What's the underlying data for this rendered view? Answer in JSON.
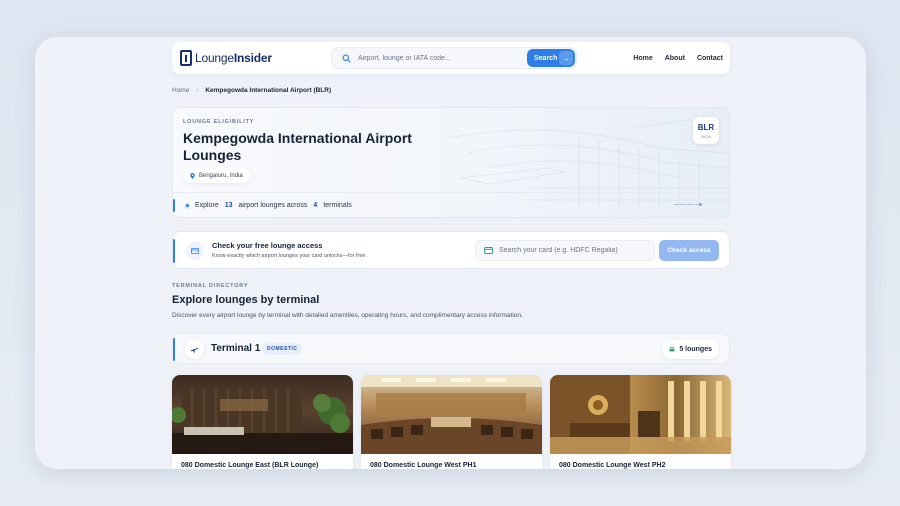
{
  "brand": {
    "logo_text_bold": "Lounge",
    "logo_text_rest": "Insider"
  },
  "search": {
    "placeholder": "Airport, lounge or IATA code...",
    "button_label": "Search"
  },
  "nav": {
    "links": [
      "Home",
      "About",
      "Contact"
    ]
  },
  "breadcrumb": {
    "home": "Home",
    "current": "Kempegowda International Airport (BLR)"
  },
  "hero": {
    "eyebrow": "LOUNGE ELIGIBILITY",
    "title_line1": "Kempegowda International Airport",
    "title_line2": "Lounges",
    "location": "Bengaluru, India",
    "iata_code": "BLR",
    "iata_label": "IATA",
    "explore_prefix": "Explore",
    "lounge_count": "13",
    "explore_middle": "airport lounges across",
    "terminal_count": "4",
    "explore_suffix": "terminals"
  },
  "check_access": {
    "title": "Check your free lounge access",
    "subtitle": "Know exactly which airport lounges your card unlocks—for free.",
    "input_placeholder": "Search your card (e.g. HDFC Regalia)",
    "button_label": "Check access"
  },
  "directory": {
    "eyebrow": "TERMINAL DIRECTORY",
    "title": "Explore lounges by terminal",
    "subtitle": "Discover every airport lounge by terminal with detailed amenities, operating hours, and complimentary access information."
  },
  "terminal": {
    "name": "Terminal 1",
    "badge": "DOMESTIC",
    "count": "5 lounges"
  },
  "lounges": [
    {
      "name": "080 Domestic Lounge East (BLR Lounge)"
    },
    {
      "name": "080 Domestic Lounge West PH1"
    },
    {
      "name": "080 Domestic Lounge West PH2"
    }
  ],
  "colors": {
    "accent": "#2e7ee6",
    "navy": "#13306b",
    "check_button": "#93b9f0"
  }
}
